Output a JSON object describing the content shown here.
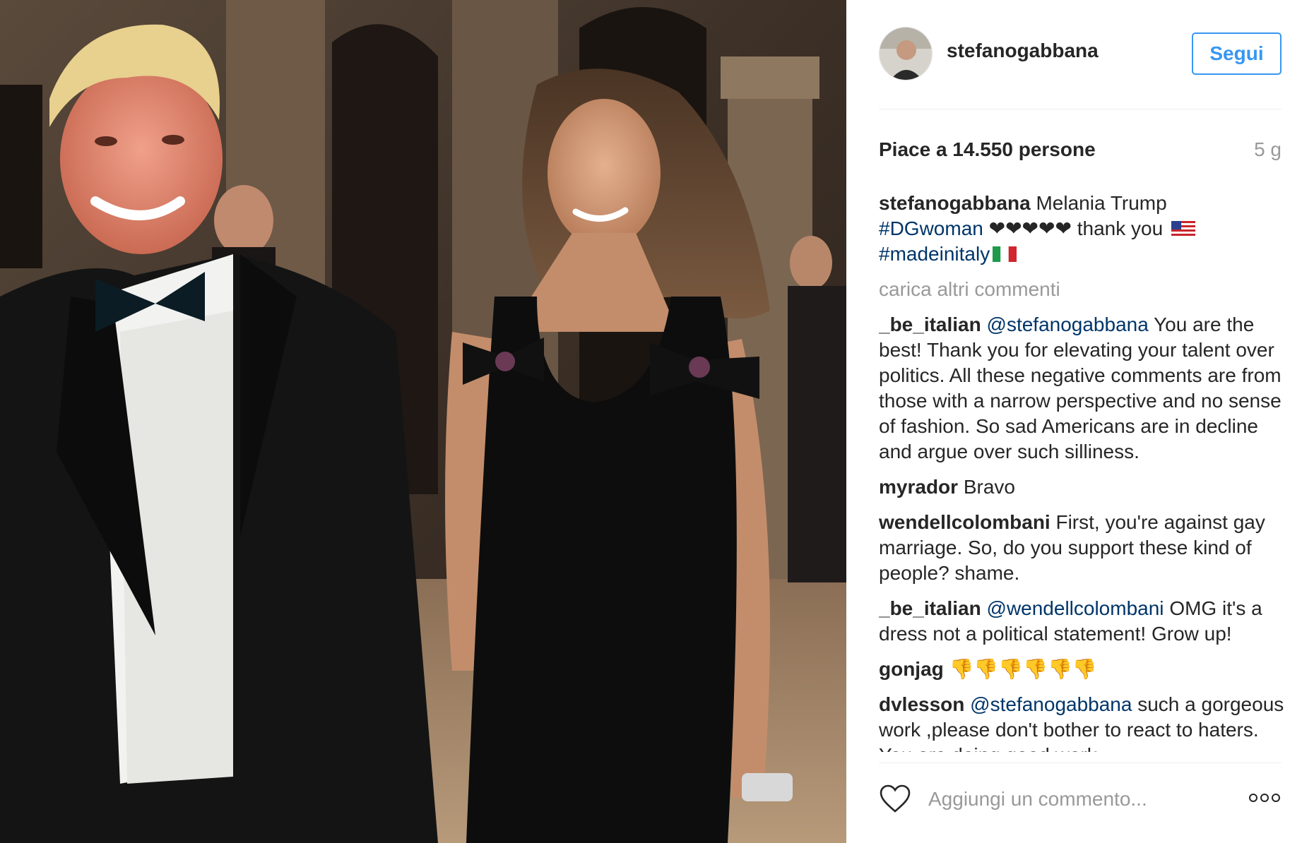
{
  "post": {
    "username": "stefanogabbana",
    "follow_label": "Segui",
    "likes": "Piace a 14.550 persone",
    "time": "5 g"
  },
  "caption": {
    "user": "stefanogabbana",
    "text": "Melania Trump",
    "tag1": "#DGwoman",
    "hearts": "❤❤❤❤❤",
    "thanks": "thank you",
    "tag2": "#madeinitaly"
  },
  "load_more": "carica altri commenti",
  "comments": [
    {
      "user": "_be_italian",
      "mention": "@stefanogabbana",
      "text": "You are the best! Thank you for elevating your talent over politics. All these negative comments are from those with a narrow perspective and no sense of fashion. So sad Americans are in decline and argue over such silliness."
    },
    {
      "user": "myrador",
      "mention": "",
      "text": "Bravo"
    },
    {
      "user": "wendellcolombani",
      "mention": "",
      "text": "First, you're against gay marriage. So, do you support these kind of people? shame."
    },
    {
      "user": "_be_italian",
      "mention": "@wendellcolombani",
      "text": "OMG it's a dress not a political statement! Grow up!"
    },
    {
      "user": "gonjag",
      "mention": "",
      "text": "👎👎👎👎👎👎"
    },
    {
      "user": "dvlesson",
      "mention": "@stefanogabbana",
      "text": "such a gorgeous work ,please don't bother to react to haters. You are doing good work"
    }
  ],
  "comment_input": {
    "placeholder": "Aggiungi un commento..."
  },
  "colors": {
    "accent": "#3897f0",
    "hashtag": "#003569",
    "muted": "#999999"
  },
  "icons": [
    "heart-icon",
    "more-options-icon",
    "us-flag-icon",
    "italy-flag-icon"
  ]
}
